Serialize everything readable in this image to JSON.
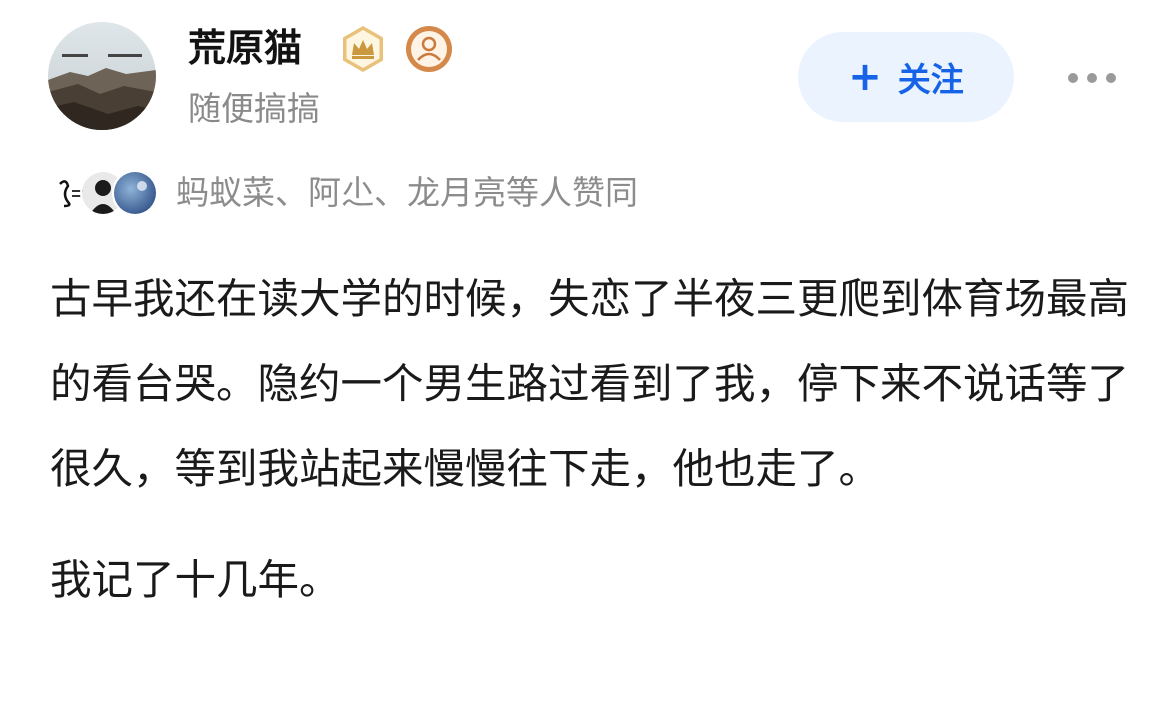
{
  "author": {
    "name": "荒原猫",
    "bio": "随便搞搞",
    "avatar_icon": "landscape-avatar-icon",
    "badges": [
      "crown-badge-icon",
      "person-badge-icon"
    ]
  },
  "actions": {
    "follow_icon": "plus-icon",
    "follow_label": "关注",
    "more_icon": "more-dots-icon"
  },
  "likes": {
    "text": "蚂蚁菜、阿尐、龙月亮等人赞同",
    "avatar_icons": [
      "liker-avatar-calligraphy",
      "liker-avatar-silhouette",
      "liker-avatar-sky"
    ]
  },
  "post": {
    "paragraphs": [
      "古早我还在读大学的时候，失恋了半夜三更爬到体育场最高的看台哭。隐约一个男生路过看到了我，停下来不说话等了很久，等到我站起来慢慢往下走，他也走了。",
      "我记了十几年。"
    ]
  },
  "colors": {
    "accent": "#1763e8",
    "follow_bg": "#ebf3ff",
    "muted_text": "#8a8a8a",
    "body_text": "#1a1a1a",
    "badge_gold": "#c9983f"
  }
}
